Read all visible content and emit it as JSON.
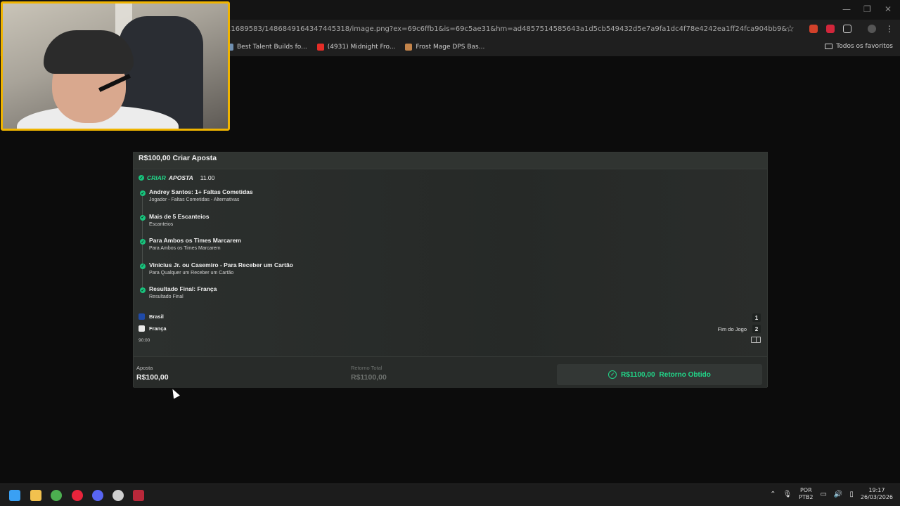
{
  "browser": {
    "url": "11689583/1486849164347445318/image.png?ex=69c6ffb1&is=69c5ae31&hm=ad4857514585643a1d5cb549432d5e7a9fa1dc4f78e4242ea1ff24fca904bb9&",
    "bookmarks": [
      {
        "label": "Best Talent Builds fo...",
        "icon": "bookmark-icon",
        "color": "#6f8fb0"
      },
      {
        "label": "(4931) Midnight Fro...",
        "icon": "youtube-icon",
        "color": "#e52d27"
      },
      {
        "label": "Frost Mage DPS Bas...",
        "icon": "frost-mage-icon",
        "color": "#c4844a"
      }
    ],
    "favorites_label": "Todos os favoritos"
  },
  "bet": {
    "title": "R$100,00 Criar Aposta",
    "combo_label_a": "CRIAR",
    "combo_label_b": "APOSTA",
    "combo_odds": "11.00",
    "legs": [
      {
        "title": "Andrey Santos: 1+ Faltas Cometidas",
        "sub": "Jogador - Faltas Cometidas - Alternativas"
      },
      {
        "title": "Mais de 5 Escanteios",
        "sub": "Escanteios"
      },
      {
        "title": "Para Ambos os Times Marcarem",
        "sub": "Para Ambos os Times Marcarem"
      },
      {
        "title": "Vinicius Jr. ou Casemiro - Para Receber um Cartão",
        "sub": "Para Qualquer um Receber um Cartão"
      },
      {
        "title": "Resultado Final: França",
        "sub": "Resultado Final"
      }
    ],
    "teams": [
      {
        "name": "Brasil",
        "score": "1",
        "icon": "brazil-shirt-icon",
        "color": "#1f4aa8"
      },
      {
        "name": "França",
        "score": "2",
        "icon": "france-shirt-icon",
        "color": "#e9e9e9"
      }
    ],
    "status": "Fim do Jogo",
    "time": "90:00",
    "stake_label": "Aposta",
    "stake_value": "R$100,00",
    "return_label": "Retorno Total",
    "return_value": "R$1100,00",
    "result_amount": "R$1100,00",
    "result_label": "Retorno Obtido",
    "accent": "#21d88a"
  },
  "taskbar": {
    "apps": [
      {
        "name": "windows-start-icon",
        "color": "#3aa0f3"
      },
      {
        "name": "file-explorer-icon",
        "color": "#f2c14e"
      },
      {
        "name": "chrome-icon",
        "color": "#4caf50"
      },
      {
        "name": "opera-gx-icon",
        "color": "#e8243b"
      },
      {
        "name": "discord-icon",
        "color": "#5865f2"
      },
      {
        "name": "obs-icon",
        "color": "#cfcfcf"
      },
      {
        "name": "voicemod-icon",
        "color": "#b8283a"
      }
    ],
    "lang_line1": "POR",
    "lang_line2": "PTB2",
    "time": "19:17",
    "date": "26/03/2026"
  }
}
